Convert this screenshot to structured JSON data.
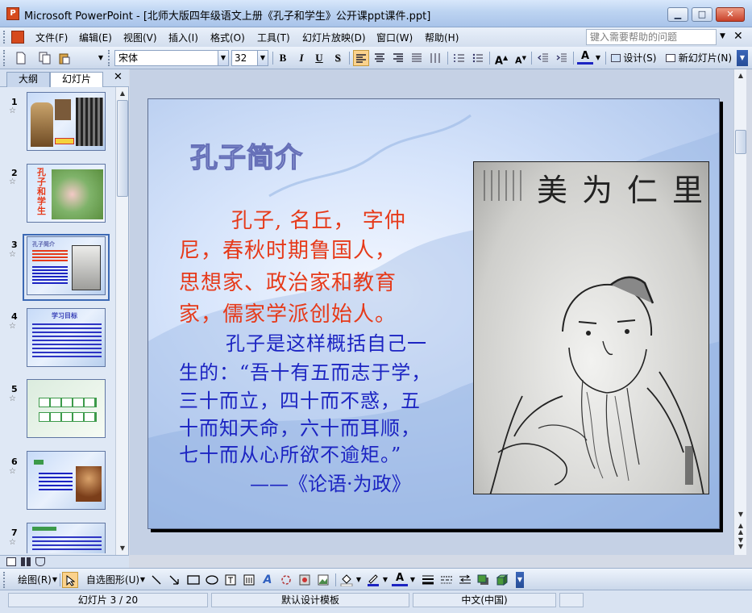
{
  "window": {
    "app_title": "Microsoft PowerPoint - [北师大版四年级语文上册《孔子和学生》公开课ppt课件.ppt]",
    "app_icon_letter": "P",
    "min": "▁",
    "max": "□",
    "close": "✕"
  },
  "menu": {
    "items": [
      "文件(F)",
      "编辑(E)",
      "视图(V)",
      "插入(I)",
      "格式(O)",
      "工具(T)",
      "幻灯片放映(D)",
      "窗口(W)",
      "帮助(H)"
    ],
    "help_placeholder": "键入需要帮助的问题",
    "close": "✕"
  },
  "toolbar": {
    "font": "宋体",
    "size": "32",
    "bold": "B",
    "italic": "I",
    "underline": "U",
    "shadow": "S",
    "font_color": "A",
    "design": "设计(S)",
    "new_slide": "新幻灯片(N)"
  },
  "left_pane": {
    "tab_outline": "大纲",
    "tab_slides": "幻灯片",
    "close": "✕",
    "slide_numbers": [
      "1",
      "2",
      "3",
      "4",
      "5",
      "6",
      "7"
    ],
    "thumb2_text": "孔子和学生",
    "thumb3_title": "孔子简介",
    "thumb4_title": "学习目标",
    "star": "☆"
  },
  "slide": {
    "title": "孔子简介",
    "red_lines": [
      "孔子, 名丘， 字仲",
      "尼，春秋时期鲁国人，",
      "思想家、政治家和教育",
      "家，儒家学派创始人。"
    ],
    "blue_lines": [
      "孔子是这样概括自己一",
      "生的：“吾十有五而志于学，",
      "三十而立，四十而不惑，五",
      "十而知天命，六十而耳顺，",
      "七十而从心所欲不逾矩。”"
    ],
    "source": "——《论语·为政》",
    "portrait_calligraphy": "里仁为美"
  },
  "drawbar": {
    "draw": "绘图(R)",
    "autoshapes": "自选图形(U)"
  },
  "status": {
    "slide_pos": "幻灯片 3 / 20",
    "template": "默认设计模板",
    "language": "中文(中国)"
  },
  "colors": {
    "title_red": "#e63a1a",
    "text_blue": "#1c24c2",
    "selection": "#3c69b4"
  }
}
